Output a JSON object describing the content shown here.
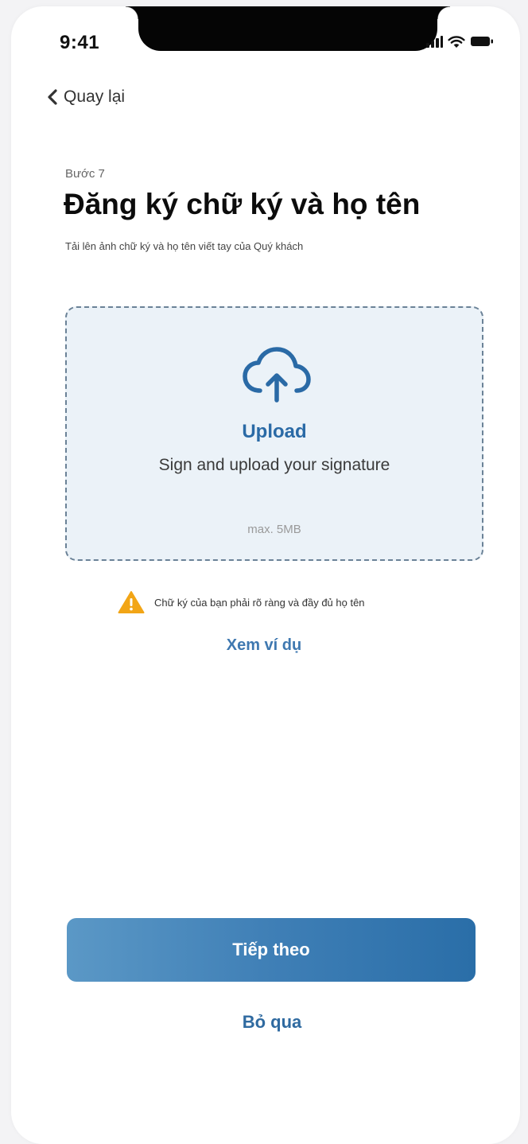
{
  "status_bar": {
    "time": "9:41",
    "icons": [
      "signal-icon",
      "wifi-icon",
      "battery-icon"
    ]
  },
  "nav": {
    "back_label": "Quay lại",
    "back_icon": "chevron-left-icon"
  },
  "header": {
    "step": "Bước 7",
    "title": "Đăng ký chữ ký và họ tên",
    "subtitle": "Tải lên ảnh chữ ký và họ tên viết tay của Quý khách"
  },
  "upload": {
    "icon": "cloud-upload-icon",
    "title": "Upload",
    "description": "Sign and upload your signature",
    "max_size": "max. 5MB"
  },
  "warning": {
    "icon": "warning-icon",
    "text": "Chữ ký của bạn phải rõ ràng và đầy đủ họ tên"
  },
  "example_link": "Xem ví dụ",
  "actions": {
    "next_label": "Tiếp theo",
    "skip_label": "Bỏ qua"
  },
  "colors": {
    "accent": "#2a6aa6",
    "upload_bg": "#ebf2f8",
    "warning": "#f2a516",
    "button_gradient_start": "#5b98c6",
    "button_gradient_end": "#2a6ea8"
  }
}
